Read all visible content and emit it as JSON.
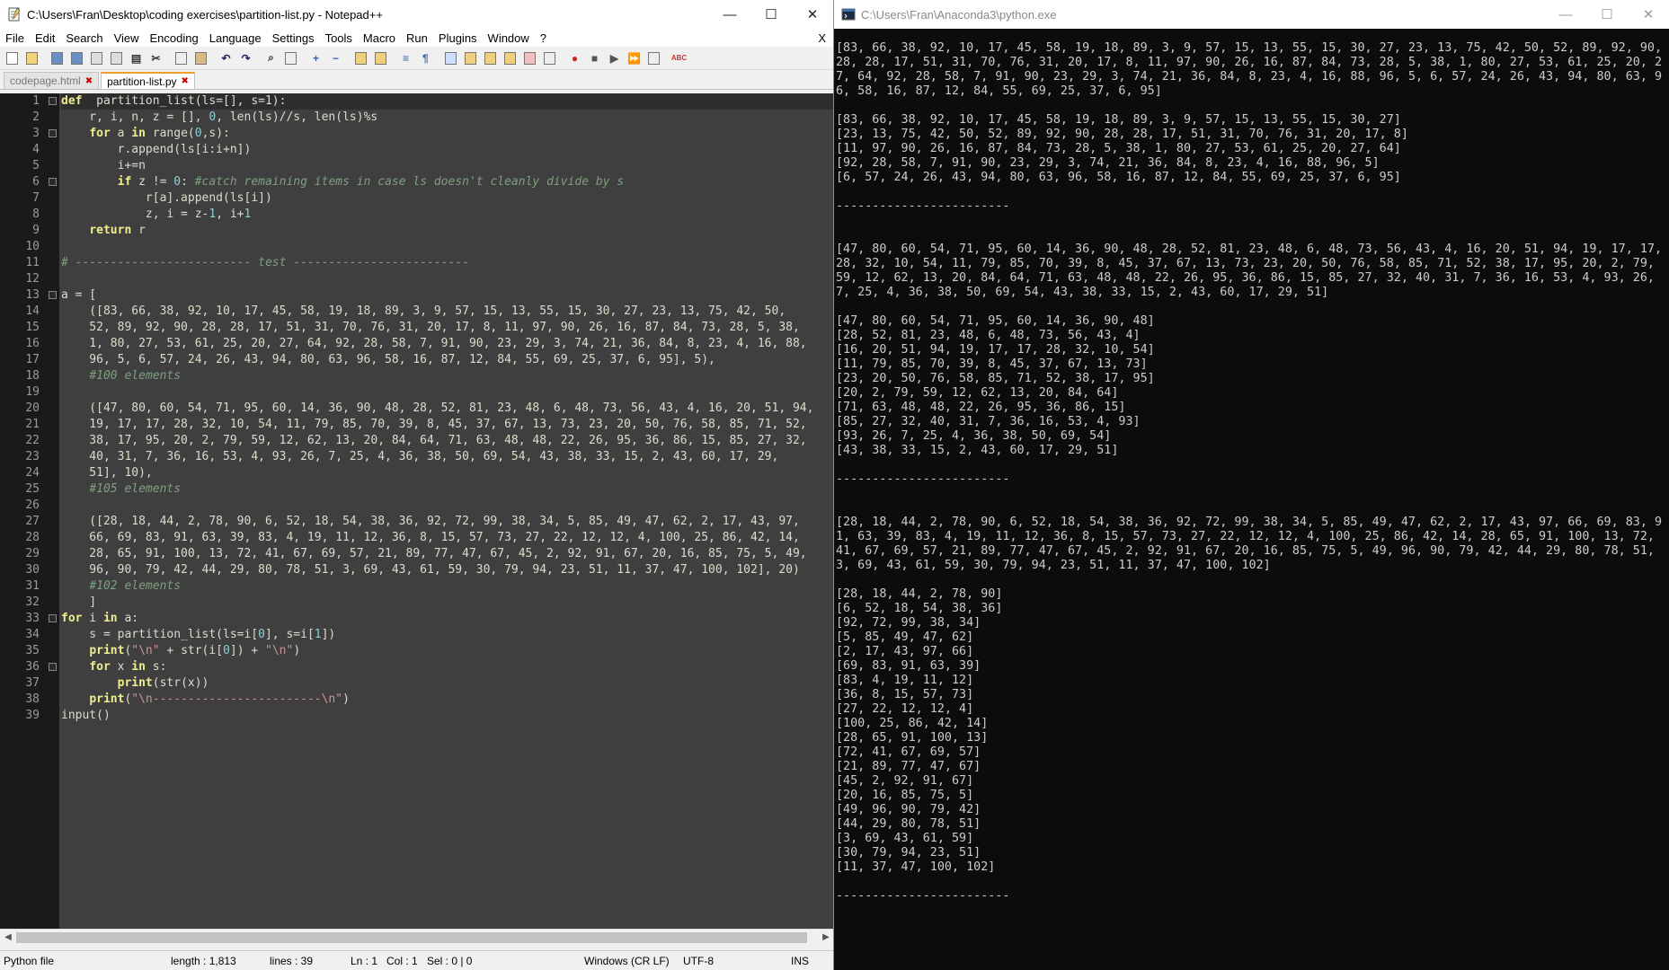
{
  "npp": {
    "title": "C:\\Users\\Fran\\Desktop\\coding exercises\\partition-list.py - Notepad++",
    "menu": [
      "File",
      "Edit",
      "Search",
      "View",
      "Encoding",
      "Language",
      "Settings",
      "Tools",
      "Macro",
      "Run",
      "Plugins",
      "Window",
      "?"
    ],
    "menu_close": "X",
    "tabs": [
      "codepage.html",
      "partition-list.py"
    ],
    "code": [
      [
        [
          "kw",
          "def"
        ],
        [
          "",
          "  partition_list(ls=[], s=1):"
        ]
      ],
      [
        [
          "",
          "    r, i, n, z = [], "
        ],
        [
          "nm",
          "0"
        ],
        [
          "",
          ", len(ls)//s, len(ls)%s"
        ]
      ],
      [
        [
          "",
          "    "
        ],
        [
          "kw",
          "for"
        ],
        [
          "",
          " a "
        ],
        [
          "kw",
          "in"
        ],
        [
          "",
          " range("
        ],
        [
          "nm",
          "0"
        ],
        [
          "",
          ",s):"
        ]
      ],
      [
        [
          "",
          "        r.append(ls[i:i+n])"
        ]
      ],
      [
        [
          "",
          "        i+=n"
        ]
      ],
      [
        [
          "",
          "        "
        ],
        [
          "kw",
          "if"
        ],
        [
          "",
          " z != "
        ],
        [
          "nm",
          "0"
        ],
        [
          "",
          ": "
        ],
        [
          "cm",
          "#catch remaining items in case ls doesn't cleanly divide by s"
        ]
      ],
      [
        [
          "",
          "            r[a].append(ls[i])"
        ]
      ],
      [
        [
          "",
          "            z, i = z-"
        ],
        [
          "nm",
          "1"
        ],
        [
          "",
          ", i+"
        ],
        [
          "nm",
          "1"
        ]
      ],
      [
        [
          "",
          "    "
        ],
        [
          "kw",
          "return"
        ],
        [
          "",
          " r"
        ]
      ],
      [
        [
          "",
          ""
        ]
      ],
      [
        [
          "cm",
          "# ------------------------- test -------------------------"
        ]
      ],
      [
        [
          "",
          ""
        ]
      ],
      [
        [
          "",
          "a = ["
        ]
      ],
      [
        [
          "",
          "    ([83, 66, 38, 92, 10, 17, 45, 58, 19, 18, 89, 3, 9, 57, 15, 13, 55, 15, 30, 27, 23, 13, 75, 42, 50,"
        ]
      ],
      [
        [
          "",
          "    52, 89, 92, 90, 28, 28, 17, 51, 31, 70, 76, 31, 20, 17, 8, 11, 97, 90, 26, 16, 87, 84, 73, 28, 5, 38,"
        ]
      ],
      [
        [
          "",
          "    1, 80, 27, 53, 61, 25, 20, 27, 64, 92, 28, 58, 7, 91, 90, 23, 29, 3, 74, 21, 36, 84, 8, 23, 4, 16, 88,"
        ]
      ],
      [
        [
          "",
          "    96, 5, 6, 57, 24, 26, 43, 94, 80, 63, 96, 58, 16, 87, 12, 84, 55, 69, 25, 37, 6, 95], 5),"
        ]
      ],
      [
        [
          "",
          "    "
        ],
        [
          "cm",
          "#100 elements"
        ]
      ],
      [
        [
          "",
          ""
        ]
      ],
      [
        [
          "",
          "    ([47, 80, 60, 54, 71, 95, 60, 14, 36, 90, 48, 28, 52, 81, 23, 48, 6, 48, 73, 56, 43, 4, 16, 20, 51, 94,"
        ]
      ],
      [
        [
          "",
          "    19, 17, 17, 28, 32, 10, 54, 11, 79, 85, 70, 39, 8, 45, 37, 67, 13, 73, 23, 20, 50, 76, 58, 85, 71, 52,"
        ]
      ],
      [
        [
          "",
          "    38, 17, 95, 20, 2, 79, 59, 12, 62, 13, 20, 84, 64, 71, 63, 48, 48, 22, 26, 95, 36, 86, 15, 85, 27, 32,"
        ]
      ],
      [
        [
          "",
          "    40, 31, 7, 36, 16, 53, 4, 93, 26, 7, 25, 4, 36, 38, 50, 69, 54, 43, 38, 33, 15, 2, 43, 60, 17, 29,"
        ]
      ],
      [
        [
          "",
          "    51], 10),"
        ]
      ],
      [
        [
          "",
          "    "
        ],
        [
          "cm",
          "#105 elements"
        ]
      ],
      [
        [
          "",
          ""
        ]
      ],
      [
        [
          "",
          "    ([28, 18, 44, 2, 78, 90, 6, 52, 18, 54, 38, 36, 92, 72, 99, 38, 34, 5, 85, 49, 47, 62, 2, 17, 43, 97,"
        ]
      ],
      [
        [
          "",
          "    66, 69, 83, 91, 63, 39, 83, 4, 19, 11, 12, 36, 8, 15, 57, 73, 27, 22, 12, 12, 4, 100, 25, 86, 42, 14,"
        ]
      ],
      [
        [
          "",
          "    28, 65, 91, 100, 13, 72, 41, 67, 69, 57, 21, 89, 77, 47, 67, 45, 2, 92, 91, 67, 20, 16, 85, 75, 5, 49,"
        ]
      ],
      [
        [
          "",
          "    96, 90, 79, 42, 44, 29, 80, 78, 51, 3, 69, 43, 61, 59, 30, 79, 94, 23, 51, 11, 37, 47, 100, 102], 20)"
        ]
      ],
      [
        [
          "",
          "    "
        ],
        [
          "cm",
          "#102 elements"
        ]
      ],
      [
        [
          "",
          "    ]"
        ]
      ],
      [
        [
          "kw",
          "for"
        ],
        [
          "",
          " i "
        ],
        [
          "kw",
          "in"
        ],
        [
          "",
          " a:"
        ]
      ],
      [
        [
          "",
          "    s = partition_list(ls=i["
        ],
        [
          "nm",
          "0"
        ],
        [
          "",
          "], s=i["
        ],
        [
          "nm",
          "1"
        ],
        [
          "",
          "])"
        ]
      ],
      [
        [
          "",
          "    "
        ],
        [
          "kw",
          "print"
        ],
        [
          "",
          "("
        ],
        [
          "st",
          "\"\\n\""
        ],
        [
          "",
          " + str(i["
        ],
        [
          "nm",
          "0"
        ],
        [
          "",
          "]) + "
        ],
        [
          "st",
          "\"\\n\""
        ],
        [
          "",
          ")"
        ]
      ],
      [
        [
          "",
          "    "
        ],
        [
          "kw",
          "for"
        ],
        [
          "",
          " x "
        ],
        [
          "kw",
          "in"
        ],
        [
          "",
          " s:"
        ]
      ],
      [
        [
          "",
          "        "
        ],
        [
          "kw",
          "print"
        ],
        [
          "",
          "(str(x))"
        ]
      ],
      [
        [
          "",
          "    "
        ],
        [
          "kw",
          "print"
        ],
        [
          "",
          "("
        ],
        [
          "st",
          "\"\\n------------------------\\n\""
        ],
        [
          "",
          ")"
        ]
      ],
      [
        [
          "",
          "input()"
        ]
      ]
    ],
    "status": {
      "type": "Python file",
      "length": "length : 1,813",
      "lines": "lines : 39",
      "ln": "Ln : 1",
      "col": "Col : 1",
      "sel": "Sel : 0 | 0",
      "eol": "Windows (CR LF)",
      "enc": "UTF-8",
      "mode": "INS"
    }
  },
  "console": {
    "title": "C:\\Users\\Fran\\Anaconda3\\python.exe",
    "lines": [
      "[83, 66, 38, 92, 10, 17, 45, 58, 19, 18, 89, 3, 9, 57, 15, 13, 55, 15, 30, 27, 23, 13, 75, 42, 50, 52, 89, 92, 90, 28, 28, 17, 51, 31, 70, 76, 31, 20, 17, 8, 11, 97, 90, 26, 16, 87, 84, 73, 28, 5, 38, 1, 80, 27, 53, 61, 25, 20, 27, 64, 92, 28, 58, 7, 91, 90, 23, 29, 3, 74, 21, 36, 84, 8, 23, 4, 16, 88, 96, 5, 6, 57, 24, 26, 43, 94, 80, 63, 96, 58, 16, 87, 12, 84, 55, 69, 25, 37, 6, 95]",
      "",
      "[83, 66, 38, 92, 10, 17, 45, 58, 19, 18, 89, 3, 9, 57, 15, 13, 55, 15, 30, 27]",
      "[23, 13, 75, 42, 50, 52, 89, 92, 90, 28, 28, 17, 51, 31, 70, 76, 31, 20, 17, 8]",
      "[11, 97, 90, 26, 16, 87, 84, 73, 28, 5, 38, 1, 80, 27, 53, 61, 25, 20, 27, 64]",
      "[92, 28, 58, 7, 91, 90, 23, 29, 3, 74, 21, 36, 84, 8, 23, 4, 16, 88, 96, 5]",
      "[6, 57, 24, 26, 43, 94, 80, 63, 96, 58, 16, 87, 12, 84, 55, 69, 25, 37, 6, 95]",
      "",
      "------------------------",
      "",
      "",
      "[47, 80, 60, 54, 71, 95, 60, 14, 36, 90, 48, 28, 52, 81, 23, 48, 6, 48, 73, 56, 43, 4, 16, 20, 51, 94, 19, 17, 17, 28, 32, 10, 54, 11, 79, 85, 70, 39, 8, 45, 37, 67, 13, 73, 23, 20, 50, 76, 58, 85, 71, 52, 38, 17, 95, 20, 2, 79, 59, 12, 62, 13, 20, 84, 64, 71, 63, 48, 48, 22, 26, 95, 36, 86, 15, 85, 27, 32, 40, 31, 7, 36, 16, 53, 4, 93, 26, 7, 25, 4, 36, 38, 50, 69, 54, 43, 38, 33, 15, 2, 43, 60, 17, 29, 51]",
      "",
      "[47, 80, 60, 54, 71, 95, 60, 14, 36, 90, 48]",
      "[28, 52, 81, 23, 48, 6, 48, 73, 56, 43, 4]",
      "[16, 20, 51, 94, 19, 17, 17, 28, 32, 10, 54]",
      "[11, 79, 85, 70, 39, 8, 45, 37, 67, 13, 73]",
      "[23, 20, 50, 76, 58, 85, 71, 52, 38, 17, 95]",
      "[20, 2, 79, 59, 12, 62, 13, 20, 84, 64]",
      "[71, 63, 48, 48, 22, 26, 95, 36, 86, 15]",
      "[85, 27, 32, 40, 31, 7, 36, 16, 53, 4, 93]",
      "[93, 26, 7, 25, 4, 36, 38, 50, 69, 54]",
      "[43, 38, 33, 15, 2, 43, 60, 17, 29, 51]",
      "",
      "------------------------",
      "",
      "",
      "[28, 18, 44, 2, 78, 90, 6, 52, 18, 54, 38, 36, 92, 72, 99, 38, 34, 5, 85, 49, 47, 62, 2, 17, 43, 97, 66, 69, 83, 91, 63, 39, 83, 4, 19, 11, 12, 36, 8, 15, 57, 73, 27, 22, 12, 12, 4, 100, 25, 86, 42, 14, 28, 65, 91, 100, 13, 72, 41, 67, 69, 57, 21, 89, 77, 47, 67, 45, 2, 92, 91, 67, 20, 16, 85, 75, 5, 49, 96, 90, 79, 42, 44, 29, 80, 78, 51, 3, 69, 43, 61, 59, 30, 79, 94, 23, 51, 11, 37, 47, 100, 102]",
      "",
      "[28, 18, 44, 2, 78, 90]",
      "[6, 52, 18, 54, 38, 36]",
      "[92, 72, 99, 38, 34]",
      "[5, 85, 49, 47, 62]",
      "[2, 17, 43, 97, 66]",
      "[69, 83, 91, 63, 39]",
      "[83, 4, 19, 11, 12]",
      "[36, 8, 15, 57, 73]",
      "[27, 22, 12, 12, 4]",
      "[100, 25, 86, 42, 14]",
      "[28, 65, 91, 100, 13]",
      "[72, 41, 67, 69, 57]",
      "[21, 89, 77, 47, 67]",
      "[45, 2, 92, 91, 67]",
      "[20, 16, 85, 75, 5]",
      "[49, 96, 90, 79, 42]",
      "[44, 29, 80, 78, 51]",
      "[3, 69, 43, 61, 59]",
      "[30, 79, 94, 23, 51]",
      "[11, 37, 47, 100, 102]",
      "",
      "------------------------"
    ]
  }
}
